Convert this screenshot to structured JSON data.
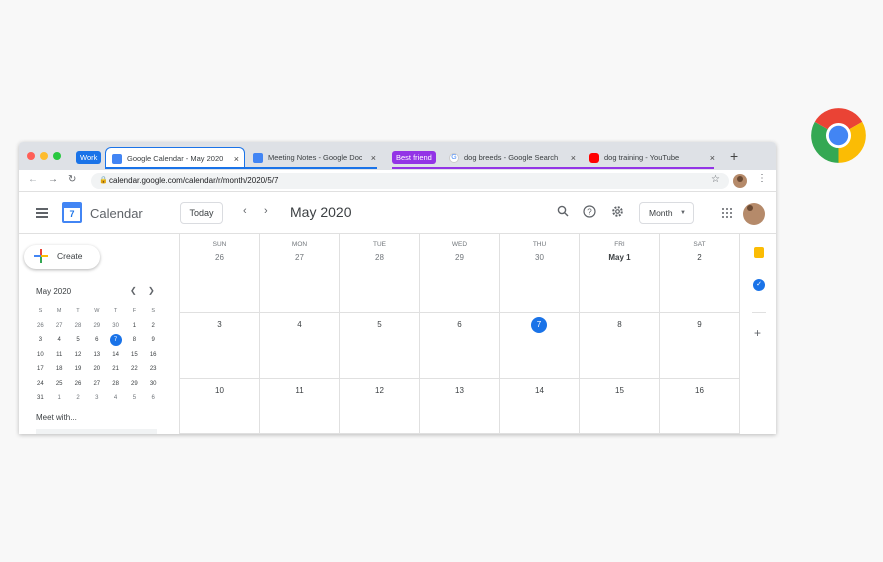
{
  "browser": {
    "groups": {
      "work": {
        "label": "Work",
        "color": "#1a73e8"
      },
      "best_friend": {
        "label": "Best friend",
        "color": "#9334e6"
      }
    },
    "tabs": [
      {
        "title": "Google Calendar - May 2020",
        "icon": "calendar-favicon",
        "active": true
      },
      {
        "title": "Meeting Notes - Google Docs",
        "icon": "docs-favicon"
      },
      {
        "title": "dog breeds - Google Search",
        "icon": "google-favicon"
      },
      {
        "title": "dog training - YouTube",
        "icon": "youtube-favicon"
      }
    ],
    "new_tab": "+",
    "close": "×",
    "url": "calendar.google.com/calendar/r/month/2020/5/7"
  },
  "calendar": {
    "app_title": "Calendar",
    "logo_day": "7",
    "today_button": "Today",
    "month_title": "May 2020",
    "view_selector": "Month",
    "create_button": "Create",
    "mini": {
      "title": "May 2020",
      "dow": [
        "S",
        "M",
        "T",
        "W",
        "T",
        "F",
        "S"
      ],
      "weeks": [
        [
          "26",
          "27",
          "28",
          "29",
          "30",
          "1",
          "2"
        ],
        [
          "3",
          "4",
          "5",
          "6",
          "7",
          "8",
          "9"
        ],
        [
          "10",
          "11",
          "12",
          "13",
          "14",
          "15",
          "16"
        ],
        [
          "17",
          "18",
          "19",
          "20",
          "21",
          "22",
          "23"
        ],
        [
          "24",
          "25",
          "26",
          "27",
          "28",
          "29",
          "30"
        ],
        [
          "31",
          "1",
          "2",
          "3",
          "4",
          "5",
          "6"
        ]
      ],
      "selected": "7"
    },
    "meet_with": "Meet with...",
    "grid": {
      "dow": [
        "SUN",
        "MON",
        "TUE",
        "WED",
        "THU",
        "FRI",
        "SAT"
      ],
      "weeks": [
        [
          "26",
          "27",
          "28",
          "29",
          "30",
          "May 1",
          "2"
        ],
        [
          "3",
          "4",
          "5",
          "6",
          "7",
          "8",
          "9"
        ],
        [
          "10",
          "11",
          "12",
          "13",
          "14",
          "15",
          "16"
        ]
      ],
      "today": "7"
    }
  },
  "colors": {
    "accent": "#1a73e8",
    "youtube": "#ff0000",
    "keep": "#fbbc04"
  }
}
